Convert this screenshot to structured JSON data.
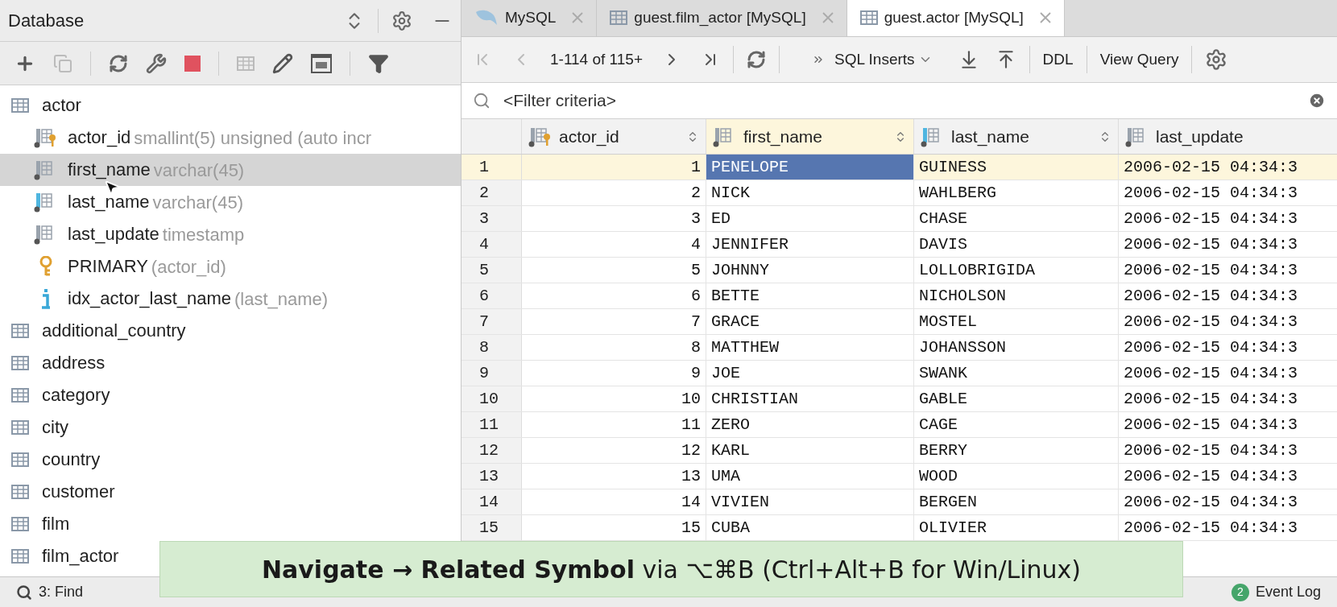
{
  "sidebar": {
    "title": "Database",
    "tree": [
      {
        "label": "actor",
        "kind": "table",
        "selected": false,
        "children": [
          {
            "label": "actor_id",
            "detail": "smallint(5) unsigned (auto incr",
            "kind": "pk_column",
            "selected": false
          },
          {
            "label": "first_name",
            "detail": "varchar(45)",
            "kind": "column",
            "selected": true
          },
          {
            "label": "last_name",
            "detail": "varchar(45)",
            "kind": "indexed_column",
            "selected": false
          },
          {
            "label": "last_update",
            "detail": "timestamp",
            "kind": "column",
            "selected": false
          },
          {
            "label": "PRIMARY",
            "detail": "(actor_id)",
            "kind": "key",
            "selected": false
          },
          {
            "label": "idx_actor_last_name",
            "detail": "(last_name)",
            "kind": "index",
            "selected": false
          }
        ]
      },
      {
        "label": "additional_country",
        "kind": "table",
        "selected": false
      },
      {
        "label": "address",
        "kind": "table",
        "selected": false
      },
      {
        "label": "category",
        "kind": "table",
        "selected": false
      },
      {
        "label": "city",
        "kind": "table",
        "selected": false
      },
      {
        "label": "country",
        "kind": "table",
        "selected": false
      },
      {
        "label": "customer",
        "kind": "table",
        "selected": false
      },
      {
        "label": "film",
        "kind": "table",
        "selected": false
      },
      {
        "label": "film_actor",
        "kind": "table",
        "selected": false
      }
    ]
  },
  "tabs": [
    {
      "label": "MySQL",
      "kind": "datasource",
      "selected": false
    },
    {
      "label": "guest.film_actor [MySQL]",
      "kind": "table",
      "selected": false
    },
    {
      "label": "guest.actor [MySQL]",
      "kind": "table",
      "selected": true
    }
  ],
  "toolbar": {
    "range": "1-114 of 115+",
    "format": "SQL Inserts",
    "ddl": "DDL",
    "view_query": "View Query"
  },
  "filter": {
    "placeholder": "<Filter criteria>"
  },
  "table": {
    "columns": [
      {
        "label": "actor_id",
        "kind": "pk_column",
        "selected": false
      },
      {
        "label": "first_name",
        "kind": "column",
        "selected": true
      },
      {
        "label": "last_name",
        "kind": "indexed_column",
        "selected": false
      },
      {
        "label": "last_update",
        "kind": "column",
        "selected": false
      }
    ],
    "rows": [
      {
        "number": "1",
        "current": true,
        "cells": [
          "1",
          "PENELOPE",
          "GUINESS",
          "2006-02-15 04:34:3"
        ]
      },
      {
        "number": "2",
        "current": false,
        "cells": [
          "2",
          "NICK",
          "WAHLBERG",
          "2006-02-15 04:34:3"
        ]
      },
      {
        "number": "3",
        "current": false,
        "cells": [
          "3",
          "ED",
          "CHASE",
          "2006-02-15 04:34:3"
        ]
      },
      {
        "number": "4",
        "current": false,
        "cells": [
          "4",
          "JENNIFER",
          "DAVIS",
          "2006-02-15 04:34:3"
        ]
      },
      {
        "number": "5",
        "current": false,
        "cells": [
          "5",
          "JOHNNY",
          "LOLLOBRIGIDA",
          "2006-02-15 04:34:3"
        ]
      },
      {
        "number": "6",
        "current": false,
        "cells": [
          "6",
          "BETTE",
          "NICHOLSON",
          "2006-02-15 04:34:3"
        ]
      },
      {
        "number": "7",
        "current": false,
        "cells": [
          "7",
          "GRACE",
          "MOSTEL",
          "2006-02-15 04:34:3"
        ]
      },
      {
        "number": "8",
        "current": false,
        "cells": [
          "8",
          "MATTHEW",
          "JOHANSSON",
          "2006-02-15 04:34:3"
        ]
      },
      {
        "number": "9",
        "current": false,
        "cells": [
          "9",
          "JOE",
          "SWANK",
          "2006-02-15 04:34:3"
        ]
      },
      {
        "number": "10",
        "current": false,
        "cells": [
          "10",
          "CHRISTIAN",
          "GABLE",
          "2006-02-15 04:34:3"
        ]
      },
      {
        "number": "11",
        "current": false,
        "cells": [
          "11",
          "ZERO",
          "CAGE",
          "2006-02-15 04:34:3"
        ]
      },
      {
        "number": "12",
        "current": false,
        "cells": [
          "12",
          "KARL",
          "BERRY",
          "2006-02-15 04:34:3"
        ]
      },
      {
        "number": "13",
        "current": false,
        "cells": [
          "13",
          "UMA",
          "WOOD",
          "2006-02-15 04:34:3"
        ]
      },
      {
        "number": "14",
        "current": false,
        "cells": [
          "14",
          "VIVIEN",
          "BERGEN",
          "2006-02-15 04:34:3"
        ]
      },
      {
        "number": "15",
        "current": false,
        "cells": [
          "15",
          "CUBA",
          "OLIVIER",
          "2006-02-15 04:34:3"
        ]
      }
    ]
  },
  "status_bar": {
    "items": [
      {
        "label": "3: Find",
        "kind": "find"
      }
    ],
    "event_log": {
      "badge": "2",
      "label": "Event Log"
    }
  },
  "hint_banner": {
    "text": "**Navigate → Related Symbol** via ⌥⌘B (Ctrl+Alt+B for Win/Linux)"
  }
}
